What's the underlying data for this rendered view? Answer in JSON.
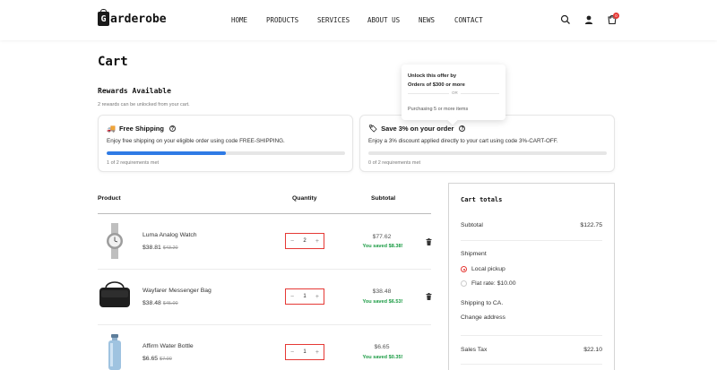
{
  "brand": {
    "logo_letter": "G",
    "name": "arderobe"
  },
  "nav": [
    "HOME",
    "PRODUCTS",
    "SERVICES",
    "ABOUT US",
    "NEWS",
    "CONTACT"
  ],
  "header_icons": [
    "search-icon",
    "user-icon",
    "cart-icon"
  ],
  "cart_count": "0",
  "page_title": "Cart",
  "rewards": {
    "title": "Rewards Available",
    "subtitle": "2 rewards can be unlocked from your cart.",
    "cards": [
      {
        "emoji": "🚚",
        "title": "Free Shipping",
        "description": "Enjoy free shipping on your eligible order using code FREE-SHIPPING.",
        "progress": 0.5,
        "meta": "1 of 2 requirements met"
      },
      {
        "emoji": "🏷",
        "title": "Save 3% on your order",
        "description": "Enjoy a 3% discount applied directly to your cart using code 3%-CART-OFF.",
        "progress": 0,
        "meta": "0 of 2 requirements met"
      }
    ],
    "tooltip": {
      "line1": "Unlock this offer by",
      "line2": "Orders of $300 or more",
      "or": "OR",
      "line3": "Purchasing 5 or more items"
    }
  },
  "table": {
    "headers": {
      "product": "Product",
      "quantity": "Quantity",
      "subtotal": "Subtotal"
    },
    "rows": [
      {
        "name": "Luma Analog Watch",
        "price": "$38.81",
        "old_price": "$43.20",
        "qty": "2",
        "subtotal": "$77.62",
        "saved": "You saved $8.38!"
      },
      {
        "name": "Wayfarer Messenger Bag",
        "price": "$38.48",
        "old_price": "$45.00",
        "qty": "1",
        "subtotal": "$38.48",
        "saved": "You saved $6.53!"
      },
      {
        "name": "Affirm Water Bottle",
        "price": "$6.65",
        "old_price": "$7.00",
        "qty": "1",
        "subtotal": "$6.65",
        "saved": "You saved $0.35!"
      }
    ],
    "minus": "−",
    "plus": "+"
  },
  "totals": {
    "title": "Cart totals",
    "subtotal_label": "Subtotal",
    "subtotal_value": "$122.75",
    "shipment_label": "Shipment",
    "options": [
      "Local pickup",
      "Flat rate: $10.00"
    ],
    "selected_option": 0,
    "shipping_to": "Shipping to CA.",
    "change_address": "Change address",
    "tax_label": "Sales Tax",
    "tax_value": "$22.10"
  },
  "colors": {
    "accent": "#e53935",
    "progress": "#2f7be5",
    "saved": "#1a9b43"
  }
}
